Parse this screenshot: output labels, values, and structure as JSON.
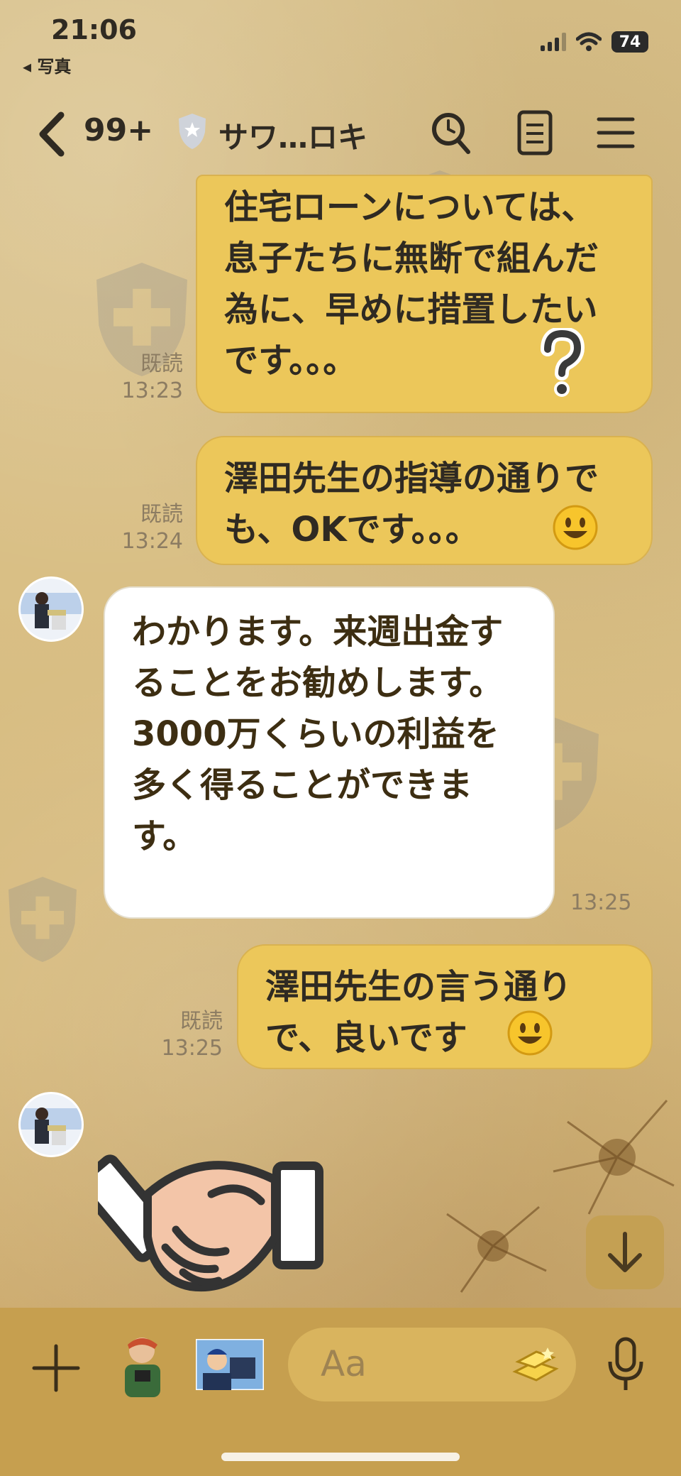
{
  "status_bar": {
    "time": "21:06",
    "back_app": "◂ 写真",
    "battery": "74"
  },
  "header": {
    "unread_count": "99+",
    "title": "サワ…ロキ"
  },
  "messages": [
    {
      "sender": "me",
      "text": "住宅ローンについては、息子たちに無断で組んだ為に、早めに措置したいです。。。",
      "read": "既読",
      "time": "13:23"
    },
    {
      "sender": "me",
      "text": "澤田先生の指導の通りでも、OKです。。。",
      "read": "既読",
      "time": "13:24"
    },
    {
      "sender": "other",
      "text": "わかります。来週出金することをお勧めします。3000万くらいの利益を多く得ることができます。",
      "time": "13:25"
    },
    {
      "sender": "me",
      "text": "澤田先生の言う通りで、良いです",
      "read": "既読",
      "time": "13:25"
    },
    {
      "sender": "other",
      "sticker": "handshake-sticker"
    }
  ],
  "input": {
    "placeholder": "Aa"
  },
  "icons": [
    "back-chevron-icon",
    "shield-icon",
    "search-icon",
    "notes-icon",
    "menu-icon",
    "plus-icon",
    "mic-icon",
    "scroll-down-icon"
  ]
}
